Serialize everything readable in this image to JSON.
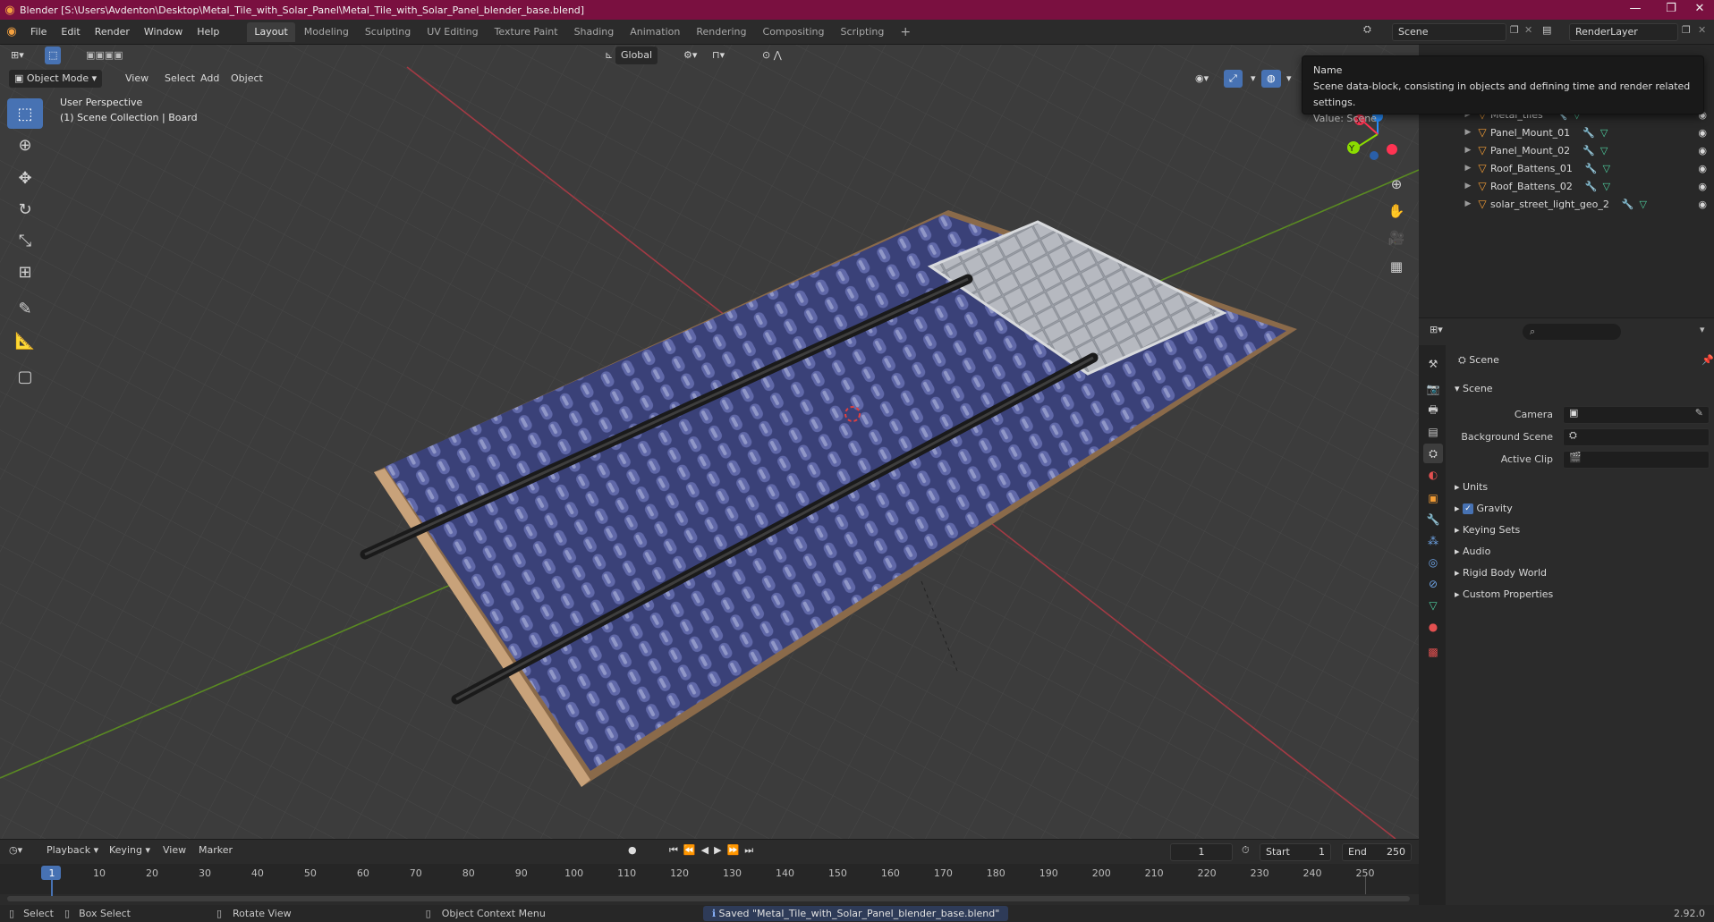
{
  "titlebar": {
    "title": "Blender [S:\\Users\\Avdenton\\Desktop\\Metal_Tile_with_Solar_Panel\\Metal_Tile_with_Solar_Panel_blender_base.blend]",
    "logo": "blender-logo",
    "color": "#7a1040"
  },
  "menu": {
    "file": "File",
    "edit": "Edit",
    "render": "Render",
    "window": "Window",
    "help": "Help"
  },
  "workspaces": [
    "Layout",
    "Modeling",
    "Sculpting",
    "UV Editing",
    "Texture Paint",
    "Shading",
    "Animation",
    "Rendering",
    "Compositing",
    "Scripting"
  ],
  "active_workspace": "Layout",
  "scene_selector": {
    "value": "Scene"
  },
  "renderlayer_selector": {
    "value": "RenderLayer"
  },
  "viewport": {
    "mode": "Object Mode",
    "menus": {
      "view": "View",
      "select": "Select",
      "add": "Add",
      "object": "Object"
    },
    "orientation": "Global",
    "info_line1": "User Perspective",
    "info_line2": "(1) Scene Collection | Board",
    "gizmo": {
      "x": "X",
      "y": "Y",
      "z": "Z"
    }
  },
  "tooltip": {
    "title": "Name",
    "description": "Scene data-block, consisting in objects and defining time and render related settings.",
    "value": "Value: Scene"
  },
  "outliner": {
    "items": [
      "Metal_tiles",
      "Panel_Mount_01",
      "Panel_Mount_02",
      "Roof_Battens_01",
      "Roof_Battens_02",
      "solar_street_light_geo_2"
    ]
  },
  "properties": {
    "header": "Scene",
    "panel": "Scene",
    "camera_label": "Camera",
    "bg_label": "Background Scene",
    "clip_label": "Active Clip",
    "sections": [
      "Units",
      "Gravity",
      "Keying Sets",
      "Audio",
      "Rigid Body World",
      "Custom Properties"
    ],
    "gravity_checked": true
  },
  "timeline": {
    "playback": "Playback",
    "keying": "Keying",
    "view": "View",
    "marker": "Marker",
    "current_frame": "1",
    "start_label": "Start",
    "start": "1",
    "end_label": "End",
    "end": "250",
    "ticks": [
      "1",
      "10",
      "20",
      "30",
      "40",
      "50",
      "60",
      "70",
      "80",
      "90",
      "100",
      "110",
      "120",
      "130",
      "140",
      "150",
      "160",
      "170",
      "180",
      "190",
      "200",
      "210",
      "220",
      "230",
      "240",
      "250"
    ]
  },
  "status": {
    "select": "Select",
    "box_select": "Box Select",
    "rotate": "Rotate View",
    "context": "Object Context Menu",
    "saved": "Saved \"Metal_Tile_with_Solar_Panel_blender_base.blend\"",
    "version": "2.92.0"
  },
  "colors": {
    "accent": "#4772b3",
    "object_orange": "#f29c35",
    "axis_x": "#ff3352",
    "axis_y": "#8bdc00",
    "axis_z": "#2890ff"
  }
}
